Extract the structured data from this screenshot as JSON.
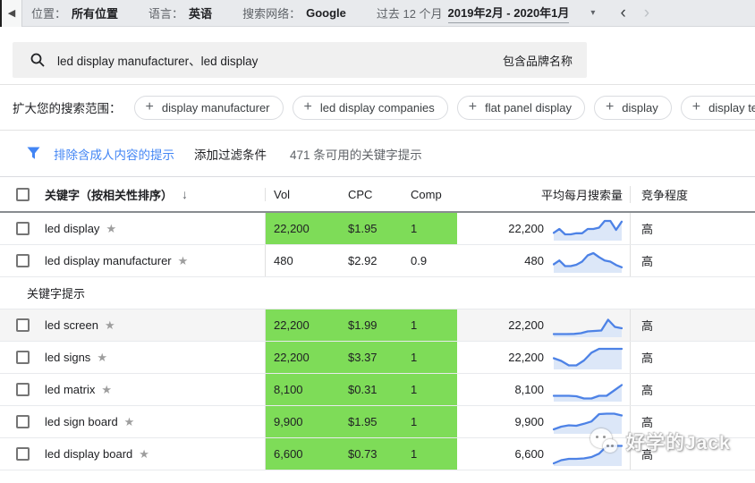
{
  "icons": {
    "back": "◀",
    "dropdown": "▾",
    "prev": "‹",
    "next": "›",
    "sort_desc": "↓",
    "star": "★",
    "plus": "+"
  },
  "colors": {
    "green_highlight": "#7edc58",
    "blue_accent": "#4285f4",
    "spark_line": "#4d82e6",
    "spark_fill": "#dce7f8"
  },
  "topbar": {
    "location_label": "位置：",
    "location_value": "所有位置",
    "language_label": "语言：",
    "language_value": "英语",
    "network_label": "搜索网络：",
    "network_value": "Google",
    "period_label": "过去 12 个月",
    "period_value": "2019年2月 - 2020年1月"
  },
  "search": {
    "query": "led display manufacturer、led display",
    "brand_label": "包含品牌名称"
  },
  "expand": {
    "label": "扩大您的搜索范围：",
    "chips": [
      "display manufacturer",
      "led display companies",
      "flat panel display",
      "display",
      "display technology"
    ],
    "partial_chip": ""
  },
  "filterbar": {
    "adult_filter": "排除含成人内容的提示",
    "add_filter": "添加过滤条件",
    "available": "471 条可用的关键字提示"
  },
  "table": {
    "headers": {
      "keyword": "关键字（按相关性排序）",
      "vol": "Vol",
      "cpc": "CPC",
      "comp": "Comp",
      "avg": "平均每月搜索量",
      "competition": "竞争程度"
    },
    "section_label": "关键字提示",
    "rows_top": [
      {
        "keyword": "led display",
        "vol": "22,200",
        "cpc": "$1.95",
        "comp": "1",
        "avg": "22,200",
        "competition": "高",
        "highlight": true,
        "shaded": false,
        "spark": [
          35,
          52,
          28,
          28,
          33,
          33,
          52,
          52,
          58,
          88,
          88,
          48,
          85
        ]
      },
      {
        "keyword": "led display manufacturer",
        "vol": "480",
        "cpc": "$2.92",
        "comp": "0.9",
        "avg": "480",
        "competition": "高",
        "highlight": false,
        "shaded": false,
        "spark": [
          38,
          55,
          30,
          30,
          36,
          50,
          78,
          88,
          70,
          55,
          50,
          35,
          25
        ]
      }
    ],
    "rows_suggestions": [
      {
        "keyword": "led screen",
        "vol": "22,200",
        "cpc": "$1.99",
        "comp": "1",
        "avg": "22,200",
        "competition": "高",
        "highlight": true,
        "shaded": true,
        "spark": [
          14,
          14,
          14,
          15,
          18,
          26,
          28,
          30,
          78,
          46,
          40
        ]
      },
      {
        "keyword": "led signs",
        "vol": "22,200",
        "cpc": "$3.37",
        "comp": "1",
        "avg": "22,200",
        "competition": "高",
        "highlight": true,
        "shaded": false,
        "spark": [
          50,
          38,
          18,
          18,
          40,
          75,
          92,
          92,
          92,
          92
        ]
      },
      {
        "keyword": "led matrix",
        "vol": "8,100",
        "cpc": "$0.31",
        "comp": "1",
        "avg": "8,100",
        "competition": "高",
        "highlight": true,
        "shaded": false,
        "spark": [
          26,
          26,
          26,
          24,
          14,
          14,
          26,
          26,
          50,
          74
        ]
      },
      {
        "keyword": "led sign board",
        "vol": "9,900",
        "cpc": "$1.95",
        "comp": "1",
        "avg": "9,900",
        "competition": "高",
        "highlight": true,
        "shaded": false,
        "spark": [
          20,
          32,
          38,
          36,
          45,
          55,
          88,
          90,
          90,
          82
        ]
      },
      {
        "keyword": "led display board",
        "vol": "6,600",
        "cpc": "$0.73",
        "comp": "1",
        "avg": "6,600",
        "competition": "高",
        "highlight": true,
        "shaded": false,
        "spark": [
          12,
          26,
          32,
          32,
          34,
          40,
          55,
          88,
          90,
          90
        ]
      }
    ]
  },
  "watermark": {
    "text": "好学的Jack"
  }
}
